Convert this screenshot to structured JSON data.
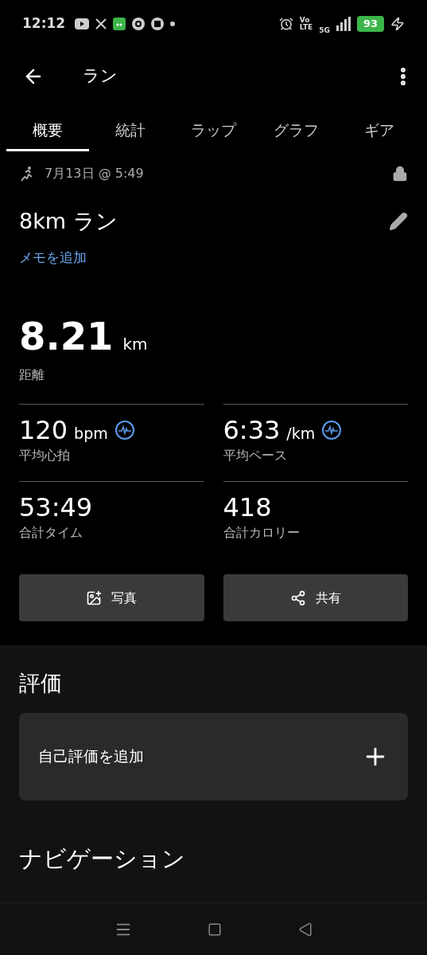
{
  "status_bar": {
    "time": "12:12",
    "volte": [
      "Vo",
      "LTE"
    ],
    "network": "5G",
    "battery": "93"
  },
  "header": {
    "title": "ラン"
  },
  "tabs": [
    {
      "label": "概要",
      "selected": true
    },
    {
      "label": "統計",
      "selected": false
    },
    {
      "label": "ラップ",
      "selected": false
    },
    {
      "label": "グラフ",
      "selected": false
    },
    {
      "label": "ギア",
      "selected": false
    }
  ],
  "activity": {
    "date": "7月13日 @ 5:49",
    "title": "8km ラン",
    "add_memo": "メモを追加"
  },
  "distance": {
    "value": "8.21",
    "unit": "km",
    "label": "距離"
  },
  "stats": [
    {
      "value": "120",
      "unit": "bpm",
      "label": "平均心拍",
      "chart_link": true
    },
    {
      "value": "6:33",
      "unit": "/km",
      "label": "平均ペース",
      "chart_link": true
    },
    {
      "value": "53:49",
      "label": "合計タイム",
      "chart_link": false
    },
    {
      "value": "418",
      "label": "合計カロリー",
      "chart_link": false
    }
  ],
  "actions": [
    {
      "kind": "photo",
      "label": "写真"
    },
    {
      "kind": "share",
      "label": "共有"
    }
  ],
  "rating": {
    "heading": "評価",
    "add_label": "自己評価を追加"
  },
  "navigation": {
    "heading": "ナビゲーション"
  }
}
